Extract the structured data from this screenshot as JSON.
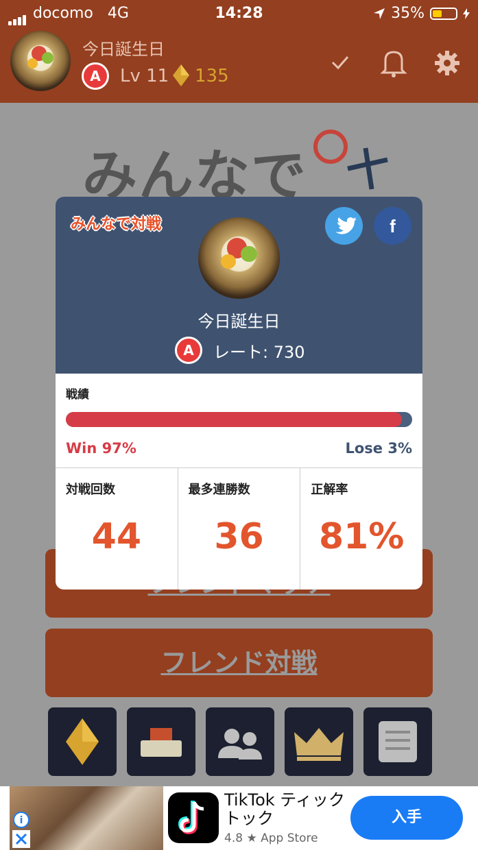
{
  "status_bar": {
    "carrier": "docomo",
    "network": "4G",
    "time": "14:28",
    "battery": "35%"
  },
  "header": {
    "username": "今日誕生日",
    "rank": "A",
    "level": "Lv 11",
    "gems": "135"
  },
  "background": {
    "title": "みんなで",
    "buttons": [
      {
        "label": "フレンドマッチ"
      },
      {
        "label": "フレンド対戦"
      }
    ],
    "tiles": [
      "gem-icon",
      "box-icon",
      "friends-icon",
      "crown-icon",
      "document-icon"
    ]
  },
  "modal": {
    "logo": "みんなで対戦",
    "profile_name": "今日誕生日",
    "rank": "A",
    "rate": "レート: 730",
    "record_label": "戦績",
    "win_fraction": 0.97,
    "win_text": "Win 97%",
    "lose_text": "Lose 3%",
    "stats": [
      {
        "label": "対戦回数",
        "value": "44"
      },
      {
        "label": "最多連勝数",
        "value": "36"
      },
      {
        "label": "正解率",
        "value": "81%"
      }
    ]
  },
  "ad": {
    "title": "TikTok ティックトック",
    "rating": "4.8 ★ App Store",
    "button": "入手"
  },
  "colors": {
    "header": "#943f1f",
    "modal_top": "#3f5370",
    "accent": "#e2552d",
    "win": "#d63c47"
  }
}
